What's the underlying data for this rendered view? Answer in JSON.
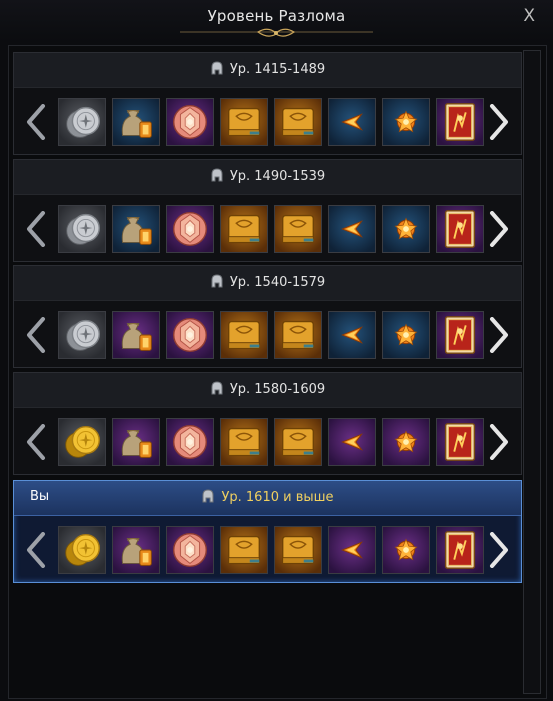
{
  "window": {
    "title": "Уровень Разлома",
    "close_label": "X"
  },
  "you_label": "Вы",
  "tiers": [
    {
      "label": "Ур. 1415-1489",
      "is_mine": false,
      "items": [
        {
          "icon": "silver-coin-icon",
          "grade": "gray"
        },
        {
          "icon": "loot-bag-icon",
          "grade": "blue"
        },
        {
          "icon": "gem-orb-icon",
          "grade": "purple"
        },
        {
          "icon": "skill-book-icon",
          "grade": "orange"
        },
        {
          "icon": "skill-book-icon",
          "grade": "orange"
        },
        {
          "icon": "fire-shard-icon",
          "grade": "blue"
        },
        {
          "icon": "fire-crystal-icon",
          "grade": "blue"
        },
        {
          "icon": "card-icon",
          "grade": "purple"
        }
      ]
    },
    {
      "label": "Ур. 1490-1539",
      "is_mine": false,
      "items": [
        {
          "icon": "silver-coin-icon",
          "grade": "gray"
        },
        {
          "icon": "loot-bag-icon",
          "grade": "blue"
        },
        {
          "icon": "gem-orb-icon",
          "grade": "purple"
        },
        {
          "icon": "skill-book-icon",
          "grade": "orange"
        },
        {
          "icon": "skill-book-icon",
          "grade": "orange"
        },
        {
          "icon": "fire-shard-icon",
          "grade": "blue"
        },
        {
          "icon": "fire-crystal-icon",
          "grade": "blue"
        },
        {
          "icon": "card-icon",
          "grade": "purple"
        }
      ]
    },
    {
      "label": "Ур. 1540-1579",
      "is_mine": false,
      "items": [
        {
          "icon": "silver-coin-icon",
          "grade": "gray"
        },
        {
          "icon": "loot-bag-icon",
          "grade": "purple"
        },
        {
          "icon": "gem-orb-icon",
          "grade": "purple"
        },
        {
          "icon": "skill-book-icon",
          "grade": "orange"
        },
        {
          "icon": "skill-book-icon",
          "grade": "orange"
        },
        {
          "icon": "fire-shard-icon",
          "grade": "blue"
        },
        {
          "icon": "fire-crystal-icon",
          "grade": "blue"
        },
        {
          "icon": "card-icon",
          "grade": "purple"
        }
      ]
    },
    {
      "label": "Ур. 1580-1609",
      "is_mine": false,
      "items": [
        {
          "icon": "gold-coin-icon",
          "grade": "gray"
        },
        {
          "icon": "loot-bag-icon",
          "grade": "purple"
        },
        {
          "icon": "gem-orb-icon",
          "grade": "purple"
        },
        {
          "icon": "skill-book-icon",
          "grade": "orange"
        },
        {
          "icon": "skill-book-icon",
          "grade": "orange"
        },
        {
          "icon": "fire-shard-icon",
          "grade": "purple"
        },
        {
          "icon": "fire-crystal-icon",
          "grade": "purple"
        },
        {
          "icon": "card-icon",
          "grade": "purple"
        }
      ]
    },
    {
      "label": "Ур. 1610 и выше",
      "is_mine": true,
      "items": [
        {
          "icon": "gold-coin-icon",
          "grade": "gray"
        },
        {
          "icon": "loot-bag-icon",
          "grade": "purple"
        },
        {
          "icon": "gem-orb-icon",
          "grade": "purple"
        },
        {
          "icon": "skill-book-icon",
          "grade": "orange"
        },
        {
          "icon": "skill-book-icon",
          "grade": "orange"
        },
        {
          "icon": "fire-shard-icon",
          "grade": "purple"
        },
        {
          "icon": "fire-crystal-icon",
          "grade": "purple"
        },
        {
          "icon": "card-icon",
          "grade": "purple"
        }
      ]
    }
  ]
}
